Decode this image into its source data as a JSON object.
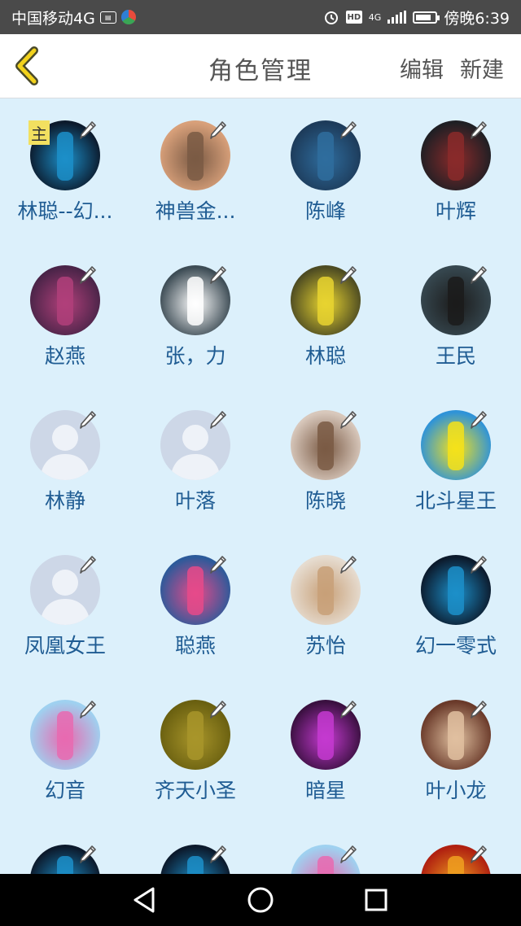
{
  "status": {
    "carrier": "中国移动4G",
    "time": "傍晚6:39",
    "hd": "HD",
    "net": "4G"
  },
  "header": {
    "title": "角色管理",
    "edit_label": "编辑",
    "new_label": "新建"
  },
  "main_badge": "主",
  "roles": [
    {
      "name": "林聪--幻...",
      "avatar": "dark-blue",
      "main": true
    },
    {
      "name": "神兽金...",
      "avatar": "tan"
    },
    {
      "name": "陈峰",
      "avatar": "blue"
    },
    {
      "name": "叶辉",
      "avatar": "dark"
    },
    {
      "name": "赵燕",
      "avatar": "purple"
    },
    {
      "name": "张，力",
      "avatar": "slate"
    },
    {
      "name": "林聪",
      "avatar": "olive"
    },
    {
      "name": "王民",
      "avatar": "slate-dark"
    },
    {
      "name": "林静",
      "avatar": "placeholder"
    },
    {
      "name": "叶落",
      "avatar": "placeholder"
    },
    {
      "name": "陈晓",
      "avatar": "photo"
    },
    {
      "name": "北斗星王",
      "avatar": "yellow"
    },
    {
      "name": "凤凰女王",
      "avatar": "placeholder"
    },
    {
      "name": "聪燕",
      "avatar": "blue-pink"
    },
    {
      "name": "苏怡",
      "avatar": "photo-light"
    },
    {
      "name": "幻一零式",
      "avatar": "dark-blue"
    },
    {
      "name": "幻音",
      "avatar": "pink"
    },
    {
      "name": "齐天小圣",
      "avatar": "olive-yellow"
    },
    {
      "name": "暗星",
      "avatar": "violet"
    },
    {
      "name": "叶小龙",
      "avatar": "brown"
    },
    {
      "name": "",
      "avatar": "dark-blue"
    },
    {
      "name": "",
      "avatar": "dark-blue"
    },
    {
      "name": "",
      "avatar": "pink"
    },
    {
      "name": "",
      "avatar": "red"
    }
  ],
  "avatar_colors": {
    "dark-blue": [
      "#0c1a2c",
      "#1c8fc9"
    ],
    "tan": [
      "#d8a07a",
      "#7a5a44"
    ],
    "blue": [
      "#1d3b5a",
      "#2f6d9e"
    ],
    "dark": [
      "#1f1f24",
      "#8a2a2a"
    ],
    "purple": [
      "#4a2448",
      "#b0407a"
    ],
    "slate": [
      "#3d4c55",
      "#ffffff"
    ],
    "olive": [
      "#4d4b22",
      "#e8d430"
    ],
    "slate-dark": [
      "#36474f",
      "#1b1b1b"
    ],
    "photo": [
      "#d8c8bc",
      "#7a5a44"
    ],
    "yellow": [
      "#2f93d8",
      "#f5e21a"
    ],
    "blue-pink": [
      "#2c5a9a",
      "#e64a8a"
    ],
    "photo-light": [
      "#e6dcd0",
      "#c8a078"
    ],
    "pink": [
      "#9fd1f0",
      "#e86ab0"
    ],
    "olive-yellow": [
      "#6a6010",
      "#a8952a"
    ],
    "violet": [
      "#3a1040",
      "#c43ad0"
    ],
    "brown": [
      "#6a3a2a",
      "#e0c0a0"
    ],
    "red": [
      "#b02010",
      "#f0a020"
    ]
  }
}
